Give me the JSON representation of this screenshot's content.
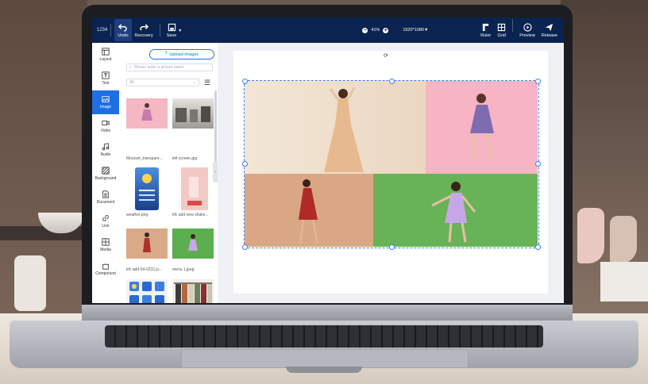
{
  "toolbar": {
    "title": "1234",
    "undo": "Undo",
    "recovery": "Recovery",
    "save": "Save",
    "zoom": "41%",
    "ratio": "1920*1080▼",
    "ruler": "Ruler",
    "grid": "Grid",
    "preview": "Preview",
    "release": "Release"
  },
  "sidebar": {
    "items": [
      {
        "label": "Layout",
        "icon": "layout-icon"
      },
      {
        "label": "Text",
        "icon": "text-icon"
      },
      {
        "label": "Image",
        "icon": "image-icon"
      },
      {
        "label": "Video",
        "icon": "video-icon"
      },
      {
        "label": "Audio",
        "icon": "audio-icon"
      },
      {
        "label": "Background",
        "icon": "background-icon"
      },
      {
        "label": "Document",
        "icon": "document-icon"
      },
      {
        "label": "Link",
        "icon": "link-icon"
      },
      {
        "label": "Media",
        "icon": "media-icon"
      },
      {
        "label": "Component",
        "icon": "component-icon"
      }
    ],
    "active": "Image"
  },
  "panel": {
    "upload_label": "Upload images",
    "search_placeholder": "Please enter a picture name",
    "filter_value": "All",
    "images": [
      {
        "name": "Mozzart_transpare..."
      },
      {
        "name": "left screen.jpg"
      },
      {
        "name": "weather.png"
      },
      {
        "name": "kfc add new shake..."
      },
      {
        "name": "kfc add-04-02(1).p..."
      },
      {
        "name": "menu 1.jpeg"
      },
      {
        "name": ""
      },
      {
        "name": ""
      }
    ]
  },
  "colors": {
    "toolbar_bg": "#0b2350",
    "accent": "#1e6fe3",
    "photo_cream": "#f1e2d0",
    "photo_pink": "#f7b6c6",
    "photo_tan": "#d9a988",
    "photo_green": "#6cb65c"
  }
}
